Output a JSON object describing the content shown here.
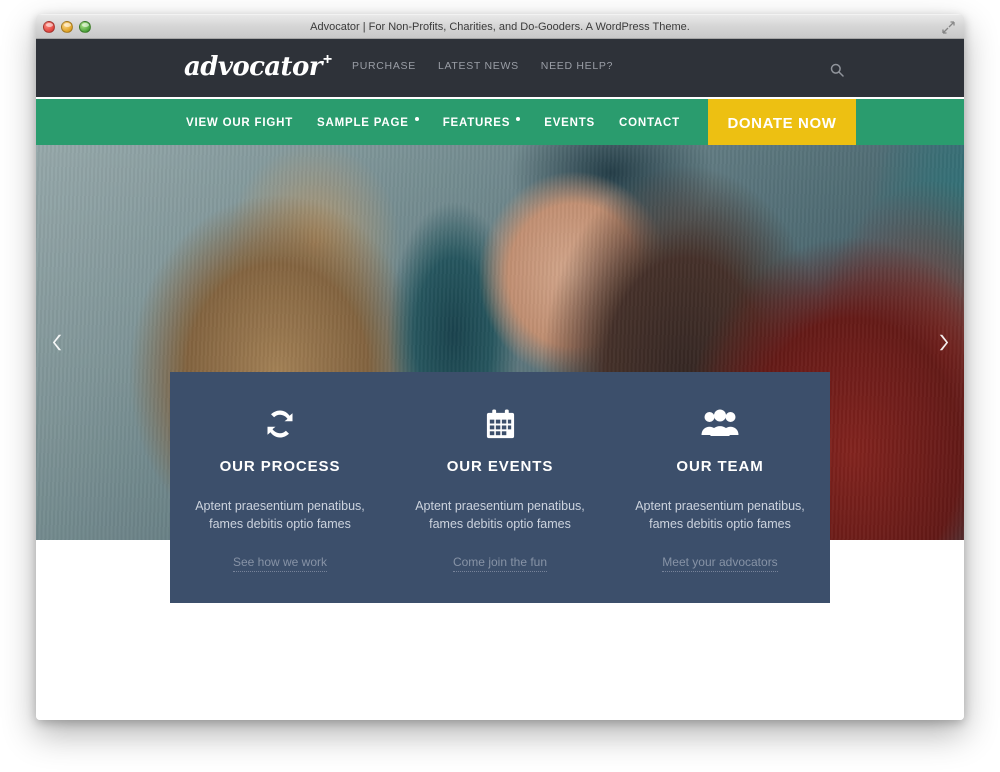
{
  "window": {
    "title": "Advocator | For Non-Profits, Charities, and Do-Gooders. A WordPress Theme.",
    "traffic_lights": [
      "close",
      "minimize",
      "zoom"
    ],
    "resize_icon": "expand-diagonal-icon"
  },
  "colors": {
    "header_dark": "#2e3239",
    "nav_green": "#2a9c6e",
    "donate_yellow": "#edc012",
    "feature_panel": "#3c4f6b",
    "page_white": "#ffffff"
  },
  "site_header": {
    "logo_text": "advocator",
    "logo_plus": "+",
    "top_links": [
      {
        "label": "PURCHASE"
      },
      {
        "label": "LATEST NEWS"
      },
      {
        "label": "NEED HELP?"
      }
    ],
    "search_icon": "search-icon"
  },
  "main_nav": {
    "items": [
      {
        "label": "VIEW OUR FIGHT",
        "has_submenu": false
      },
      {
        "label": "SAMPLE PAGE",
        "has_submenu": true
      },
      {
        "label": "FEATURES",
        "has_submenu": true
      },
      {
        "label": "EVENTS",
        "has_submenu": false
      },
      {
        "label": "CONTACT",
        "has_submenu": false
      }
    ],
    "donate_label": "DONATE NOW"
  },
  "hero": {
    "prev_icon": "chevron-left-icon",
    "next_icon": "chevron-right-icon",
    "image_description": "Smiling woman in knit hat and striped mittens hugging a fluffy dog"
  },
  "features": [
    {
      "icon": "refresh-cycle-icon",
      "title": "OUR PROCESS",
      "desc": "Aptent praesentium penatibus, fames debitis optio fames",
      "link": "See how we work"
    },
    {
      "icon": "calendar-icon",
      "title": "OUR EVENTS",
      "desc": "Aptent praesentium penatibus, fames debitis optio fames",
      "link": "Come join the fun"
    },
    {
      "icon": "users-group-icon",
      "title": "OUR TEAM",
      "desc": "Aptent praesentium penatibus, fames debitis optio fames",
      "link": "Meet your advocators"
    }
  ]
}
